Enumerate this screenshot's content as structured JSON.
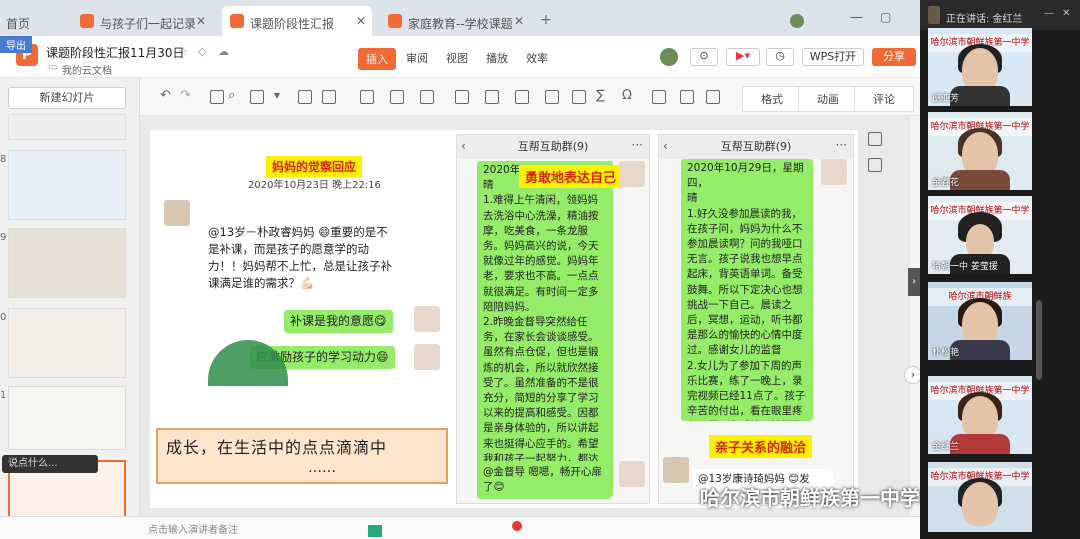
{
  "browser_tabs": [
    {
      "label": "首页",
      "active": false
    },
    {
      "label": "与孩子们一起记录",
      "active": false
    },
    {
      "label": "课题阶段性汇报",
      "active": true
    },
    {
      "label": "家庭教育--学校课题",
      "active": false
    }
  ],
  "doc": {
    "title": "课题阶段性汇报11月30日",
    "location": "我的云文档",
    "side_label": "导出"
  },
  "menu": {
    "insert": "插入",
    "review": "审阅",
    "view": "视图",
    "play": "播放",
    "efficiency": "效率",
    "wps_open": "WPS打开",
    "share": "分享"
  },
  "toolbar": {
    "tabs": [
      "格式",
      "动画",
      "评论"
    ]
  },
  "left": {
    "new_slide": "新建幻灯片",
    "slide_numbers": [
      "8",
      "9",
      "0",
      "1"
    ],
    "chat_placeholder": "说点什么...",
    "bottom_note": "点击输入演讲者备注"
  },
  "slide": {
    "header1": "妈妈的觉察回应",
    "header1_date": "2020年10月23日 晚上22:16",
    "msg1": "@13岁－朴政睿妈妈 😄重要的是不是补课，而是孩子的愿意学的动力！！妈妈帮不上忙，总是让孩子补课满足谁的需求？💪🏻",
    "reply1": "补课是我的意愿😋",
    "reply2": "应激励孩子的学习动力😄",
    "caption_line1": "成长，在生活中的点点滴滴中",
    "caption_line2": "……",
    "chat2_title": "互帮互助群(9)",
    "chat2_label": "勇敢地表达自己",
    "chat2_date": "2020年",
    "chat2_text": "晴\n1.难得上午清闲，领妈妈去洗浴中心洗澡，精油按摩，吃美食，一条龙服务。妈妈高兴的说，今天就像过年的感觉。妈妈年老，要求也不高。一点点就很满足。有时间一定多陪陪妈妈。\n2.昨晚金督导突然给任务，在家长会谈谈感受。虽然有点仓促，但也是锻炼的机会，所以就欣然接受了。虽然准备的不是很充分，简短的分享了学习以来的提高和感受。因都是亲身体验的，所以讲起来也挺得心应手的。希望我和孩子一起努力，都达成自己想达到的理想彼岸。感谢 感谢 感谢❤️❤️",
    "chat2_reply": "@金督导 嗯嗯，畅开心扉了😊",
    "chat3_title": "互帮互助群(9)",
    "chat3_date": "2020年10月29日，星期四，",
    "chat3_text": "晴\n1.好久没参加晨读的我，在孩子问，妈妈为什么不参加晨读啊？问的我哑口无言。孩子说我也想早点起床，背英语单词。备受鼓舞。所以下定决心也想挑战一下自己。晨读之后，冥想，运动，听书都是那么的愉快的心情中度过。感谢女儿的监督\n2.女儿为了参加下周的声乐比赛，练了一晚上，录完视频已经11点了。孩子辛苦的付出，看在眼里疼在心里。之后才开始写作业，估计作晚睡得很晚。感谢女儿追求梦想路上的执着。感谢 感谢感谢❤️❤️",
    "chat3_label": "亲子关系的融洽",
    "chat3_reply": "@13岁康诗琦妈妈 😊发"
  },
  "video": {
    "speaking_label": "正在讲话: 金红兰",
    "tiles": [
      {
        "name": "班亚芳",
        "banner": "哈尔滨市朝鲜族第一中学校"
      },
      {
        "name": "金春花",
        "banner": "哈尔滨市朝鲜族第一中学校"
      },
      {
        "name": "哈朝一中 姜莹援",
        "banner": "哈尔滨市朝鲜族第一中学校"
      },
      {
        "name": "朴松艳",
        "banner": "哈尔滨市朝鲜族"
      },
      {
        "name": "金红兰",
        "banner": "哈尔滨市朝鲜族第一中学校"
      },
      {
        "name": "",
        "banner": "哈尔滨市朝鲜族第一中学校"
      }
    ]
  },
  "watermark": "哈尔滨市朝鲜族第一中学校"
}
